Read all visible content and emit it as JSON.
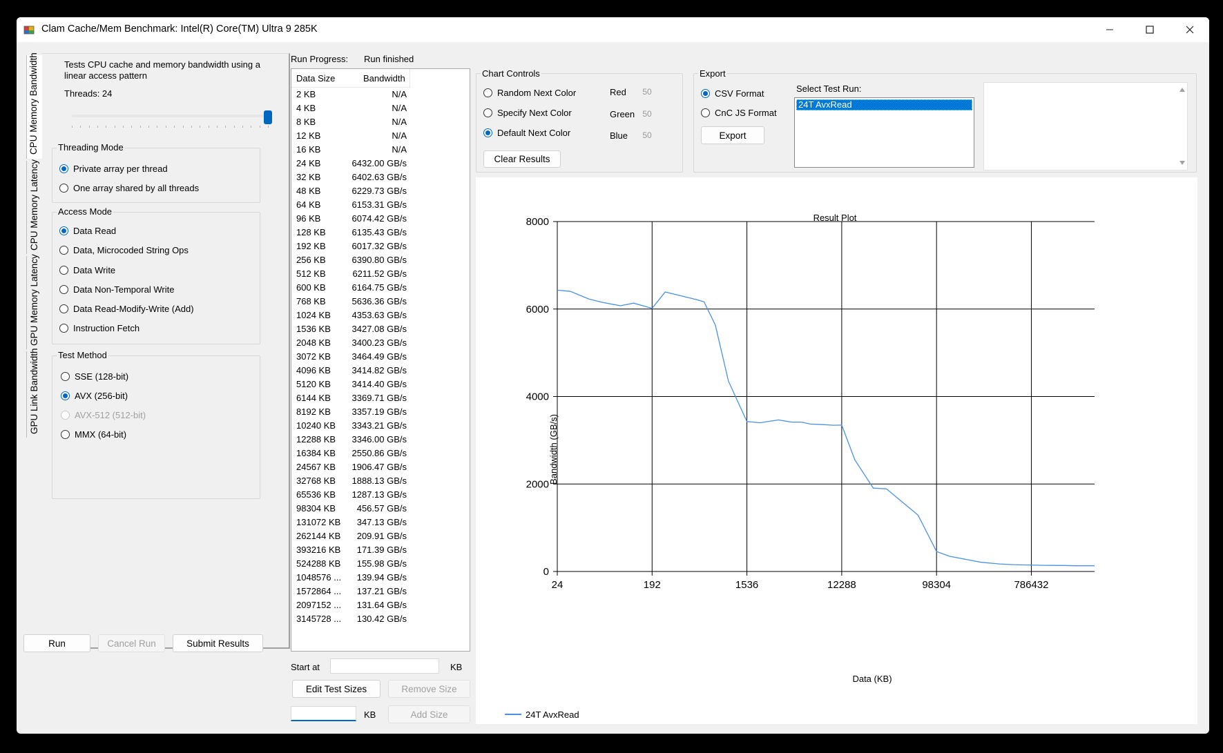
{
  "window": {
    "title": "Clam Cache/Mem Benchmark: Intel(R) Core(TM) Ultra 9 285K"
  },
  "tabs": [
    "CPU Memory Bandwidth",
    "CPU Memory Latency",
    "GPU Memory Latency",
    "GPU Link Bandwidth"
  ],
  "left_panel": {
    "description": "Tests CPU cache and memory bandwidth using a linear access pattern",
    "threads_label": "Threads: 24",
    "threads_value": 24,
    "threads_slider_fraction": 1.0,
    "threading_mode": {
      "title": "Threading Mode",
      "options": [
        "Private array per thread",
        "One array shared by all threads"
      ],
      "selected": 0
    },
    "access_mode": {
      "title": "Access Mode",
      "options": [
        "Data Read",
        "Data, Microcoded String Ops",
        "Data Write",
        "Data Non-Temporal Write",
        "Data Read-Modify-Write (Add)",
        "Instruction Fetch"
      ],
      "selected": 0
    },
    "test_method": {
      "title": "Test Method",
      "options": [
        "SSE (128-bit)",
        "AVX (256-bit)",
        "AVX-512 (512-bit)",
        "MMX (64-bit)"
      ],
      "selected": 1,
      "disabled": [
        2
      ]
    },
    "buttons": {
      "run": "Run",
      "cancel": "Cancel Run",
      "submit": "Submit Results"
    }
  },
  "progress": {
    "label": "Run Progress:",
    "status": "Run finished",
    "headers": {
      "size": "Data Size",
      "bandwidth": "Bandwidth"
    },
    "rows": [
      [
        "2 KB",
        "N/A"
      ],
      [
        "4 KB",
        "N/A"
      ],
      [
        "8 KB",
        "N/A"
      ],
      [
        "12 KB",
        "N/A"
      ],
      [
        "16 KB",
        "N/A"
      ],
      [
        "24 KB",
        "6432.00 GB/s"
      ],
      [
        "32 KB",
        "6402.63 GB/s"
      ],
      [
        "48 KB",
        "6229.73 GB/s"
      ],
      [
        "64 KB",
        "6153.31 GB/s"
      ],
      [
        "96 KB",
        "6074.42 GB/s"
      ],
      [
        "128 KB",
        "6135.43 GB/s"
      ],
      [
        "192 KB",
        "6017.32 GB/s"
      ],
      [
        "256 KB",
        "6390.80 GB/s"
      ],
      [
        "512 KB",
        "6211.52 GB/s"
      ],
      [
        "600 KB",
        "6164.75 GB/s"
      ],
      [
        "768 KB",
        "5636.36 GB/s"
      ],
      [
        "1024 KB",
        "4353.63 GB/s"
      ],
      [
        "1536 KB",
        "3427.08 GB/s"
      ],
      [
        "2048 KB",
        "3400.23 GB/s"
      ],
      [
        "3072 KB",
        "3464.49 GB/s"
      ],
      [
        "4096 KB",
        "3414.82 GB/s"
      ],
      [
        "5120 KB",
        "3414.40 GB/s"
      ],
      [
        "6144 KB",
        "3369.71 GB/s"
      ],
      [
        "8192 KB",
        "3357.19 GB/s"
      ],
      [
        "10240 KB",
        "3343.21 GB/s"
      ],
      [
        "12288 KB",
        "3346.00 GB/s"
      ],
      [
        "16384 KB",
        "2550.86 GB/s"
      ],
      [
        "24567 KB",
        "1906.47 GB/s"
      ],
      [
        "32768 KB",
        "1888.13 GB/s"
      ],
      [
        "65536 KB",
        "1287.13 GB/s"
      ],
      [
        "98304 KB",
        "456.57 GB/s"
      ],
      [
        "131072 KB",
        "347.13 GB/s"
      ],
      [
        "262144 KB",
        "209.91 GB/s"
      ],
      [
        "393216 KB",
        "171.39 GB/s"
      ],
      [
        "524288 KB",
        "155.98 GB/s"
      ],
      [
        "1048576 ...",
        "139.94 GB/s"
      ],
      [
        "1572864 ...",
        "137.21 GB/s"
      ],
      [
        "2097152 ...",
        "131.64 GB/s"
      ],
      [
        "3145728 ...",
        "130.42 GB/s"
      ]
    ],
    "start_at_label": "Start at",
    "kb_label": "KB",
    "edit_sizes": "Edit Test Sizes",
    "remove_size": "Remove Size",
    "add_size": "Add Size"
  },
  "chart_controls": {
    "title": "Chart Controls",
    "options": [
      "Random Next Color",
      "Specify Next Color",
      "Default Next Color"
    ],
    "selected": 2,
    "red_label": "Red",
    "red_value": "50",
    "green_label": "Green",
    "green_value": "50",
    "blue_label": "Blue",
    "blue_value": "50",
    "clear": "Clear Results"
  },
  "export": {
    "title": "Export",
    "options": [
      "CSV Format",
      "CnC JS Format"
    ],
    "selected": 0,
    "button": "Export",
    "select_label": "Select Test Run:",
    "runs": [
      "24T AvxRead"
    ]
  },
  "chart_data": {
    "type": "line",
    "title": "Result Plot",
    "xlabel": "Data (KB)",
    "ylabel": "Bandwidth (GB/s)",
    "x_scale": "log2",
    "xlim": [
      24,
      3145728
    ],
    "ylim": [
      0,
      8000
    ],
    "x_ticks": [
      24,
      192,
      1536,
      12288,
      98304,
      786432
    ],
    "y_ticks": [
      0,
      2000,
      4000,
      6000,
      8000
    ],
    "grid": true,
    "legend_position": "bottom-left",
    "series": [
      {
        "name": "24T AvxRead",
        "color": "#4a90e2",
        "x": [
          24,
          32,
          48,
          64,
          96,
          128,
          192,
          256,
          512,
          600,
          768,
          1024,
          1536,
          2048,
          3072,
          4096,
          5120,
          6144,
          8192,
          10240,
          12288,
          16384,
          24567,
          32768,
          65536,
          98304,
          131072,
          262144,
          393216,
          524288,
          1048576,
          1572864,
          2097152,
          3145728
        ],
        "values": [
          6432.0,
          6402.63,
          6229.73,
          6153.31,
          6074.42,
          6135.43,
          6017.32,
          6390.8,
          6211.52,
          6164.75,
          5636.36,
          4353.63,
          3427.08,
          3400.23,
          3464.49,
          3414.82,
          3414.4,
          3369.71,
          3357.19,
          3343.21,
          3346.0,
          2550.86,
          1906.47,
          1888.13,
          1287.13,
          456.57,
          347.13,
          209.91,
          171.39,
          155.98,
          139.94,
          137.21,
          131.64,
          130.42
        ]
      }
    ]
  }
}
